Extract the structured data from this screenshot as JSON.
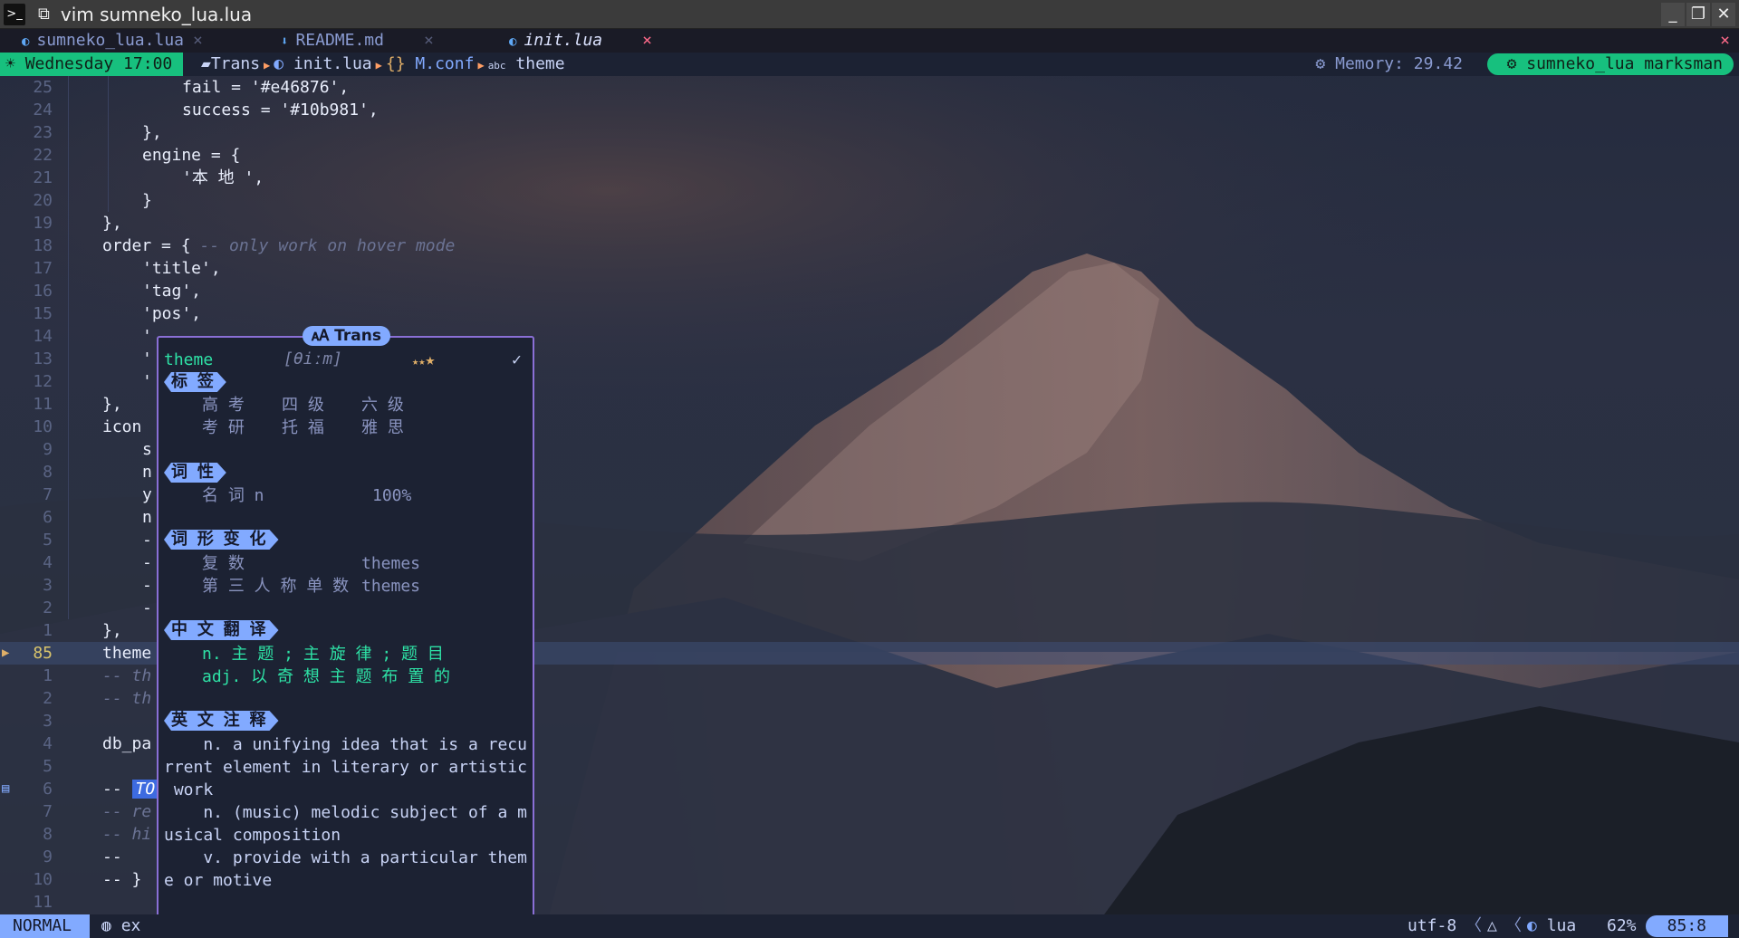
{
  "window": {
    "title": "vim sumneko_lua.lua",
    "terminal_glyph": "⧉"
  },
  "tabs": [
    {
      "label": "sumneko_lua.lua",
      "icon": "lua-icon",
      "close": "×"
    },
    {
      "label": "README.md",
      "icon": "markdown-icon",
      "close": "×"
    },
    {
      "label": "init.lua",
      "icon": "lua-icon",
      "close": "×"
    }
  ],
  "tabline_close": "×",
  "winbar": {
    "clock": "Wednesday 17:00",
    "crumbs": [
      "Trans",
      "init.lua",
      "M.conf",
      "theme"
    ],
    "memory": "Memory: 29.42",
    "lsp": "sumneko_lua  marksman"
  },
  "editor": {
    "lines": [
      {
        "n": "25",
        "indent": 2,
        "text": "fail = '#e46876',"
      },
      {
        "n": "24",
        "indent": 2,
        "text": "success = '#10b981',"
      },
      {
        "n": "23",
        "indent": 1,
        "text": "},"
      },
      {
        "n": "22",
        "indent": 1,
        "text": "engine = {"
      },
      {
        "n": "21",
        "indent": 2,
        "text": "'本 地 ',"
      },
      {
        "n": "20",
        "indent": 1,
        "text": "}"
      },
      {
        "n": "19",
        "indent": 0,
        "text": "},"
      },
      {
        "n": "18",
        "indent": 0,
        "text": "order = {",
        "comment": "-- only work on hover mode"
      },
      {
        "n": "17",
        "indent": 1,
        "text": "'title',"
      },
      {
        "n": "16",
        "indent": 1,
        "text": "'tag',"
      },
      {
        "n": "15",
        "indent": 1,
        "text": "'pos',"
      },
      {
        "n": "14",
        "indent": 1,
        "text": "'"
      },
      {
        "n": "13",
        "indent": 1,
        "text": "'"
      },
      {
        "n": "12",
        "indent": 1,
        "text": "'"
      },
      {
        "n": "11",
        "indent": 0,
        "text": "},"
      },
      {
        "n": "10",
        "indent": 0,
        "text": "icon"
      },
      {
        "n": "9",
        "indent": 1,
        "text": "s"
      },
      {
        "n": "8",
        "indent": 1,
        "text": "n"
      },
      {
        "n": "7",
        "indent": 1,
        "text": "y"
      },
      {
        "n": "6",
        "indent": 1,
        "text": "n"
      },
      {
        "n": "5",
        "indent": 1,
        "text": "-"
      },
      {
        "n": "4",
        "indent": 1,
        "text": "-"
      },
      {
        "n": "3",
        "indent": 1,
        "text": "-"
      },
      {
        "n": "2",
        "indent": 1,
        "text": "-"
      },
      {
        "n": "1",
        "indent": 0,
        "text": "},"
      },
      {
        "n": "85",
        "indent": 0,
        "text": "theme",
        "current": true
      },
      {
        "n": "1",
        "indent": 0,
        "text": "-- th",
        "comment_line": true
      },
      {
        "n": "2",
        "indent": 0,
        "text": "-- th",
        "comment_line": true
      },
      {
        "n": "3",
        "indent": 0,
        "text": ""
      },
      {
        "n": "4",
        "indent": 0,
        "text": "db_pa"
      },
      {
        "n": "5",
        "indent": 0,
        "text": ""
      },
      {
        "n": "6",
        "indent": 0,
        "text": "-- ",
        "todo": "TO"
      },
      {
        "n": "7",
        "indent": 0,
        "text": "-- re",
        "comment_line": true
      },
      {
        "n": "8",
        "indent": 0,
        "text": "-- hi",
        "comment_line": true
      },
      {
        "n": "9",
        "indent": 0,
        "text": "--"
      },
      {
        "n": "10",
        "indent": 0,
        "text": "-- }"
      },
      {
        "n": "11",
        "indent": 0,
        "text": ""
      }
    ]
  },
  "popup": {
    "title": "Trans",
    "word": "theme",
    "phonetic": "[θiːm]",
    "stars": "★★",
    "star_big": "★",
    "check": "✓",
    "sections": {
      "tag": "标 签",
      "pos": "词 性",
      "exchange": "词 形 变 化",
      "translation": "中 文 翻 译",
      "definition": "英 文 注 释"
    },
    "tags_row1": [
      "高 考",
      "四 级",
      "六 级"
    ],
    "tags_row2": [
      "考 研",
      "托 福",
      "雅 思"
    ],
    "pos_label": "名 词 n",
    "pos_pct": "100%",
    "exchange_rows": [
      {
        "k": "复 数",
        "v": "themes"
      },
      {
        "k": "第 三 人 称 单 数",
        "v": "themes"
      }
    ],
    "translation_lines": [
      "n. 主 题 ; 主 旋 律 ; 题 目",
      "adj. 以 奇 想 主 题 布 置 的"
    ],
    "definition_lines": [
      "    n. a unifying idea that is a recu",
      "rrent element in literary or artistic",
      " work",
      "    n. (music) melodic subject of a m",
      "usical composition",
      "    v. provide with a particular them",
      "e or motive"
    ]
  },
  "status": {
    "mode": "NORMAL",
    "branch": "ex",
    "encoding": "utf-8",
    "filetype": "lua",
    "percent": "62%",
    "position": "85:8"
  }
}
